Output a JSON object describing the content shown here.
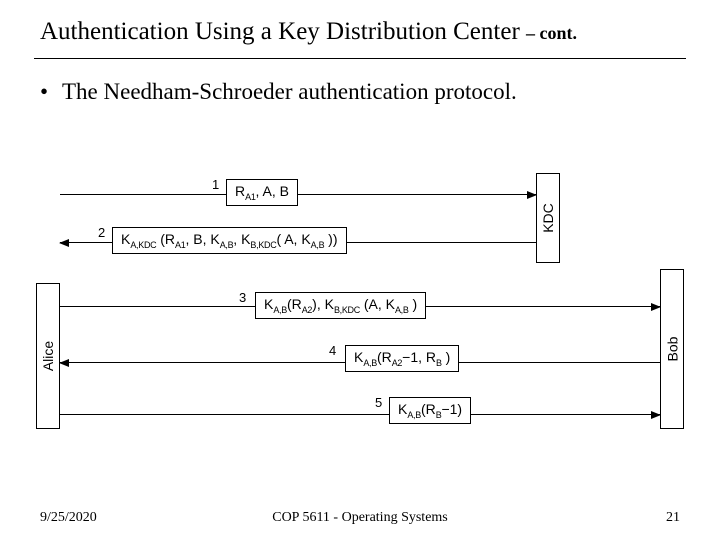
{
  "title": "Authentication Using a Key Distribution Center ",
  "title_cont": "– cont.",
  "bullet": "The Needham-Schroeder authentication protocol.",
  "actors": {
    "alice": "Alice",
    "kdc": "KDC",
    "bob": "Bob"
  },
  "steps": {
    "n1": "1",
    "n2": "2",
    "n3": "3",
    "n4": "4",
    "n5": "5"
  },
  "footer": {
    "date": "9/25/2020",
    "mid": "COP 5611 - Operating Systems",
    "page": "21"
  }
}
